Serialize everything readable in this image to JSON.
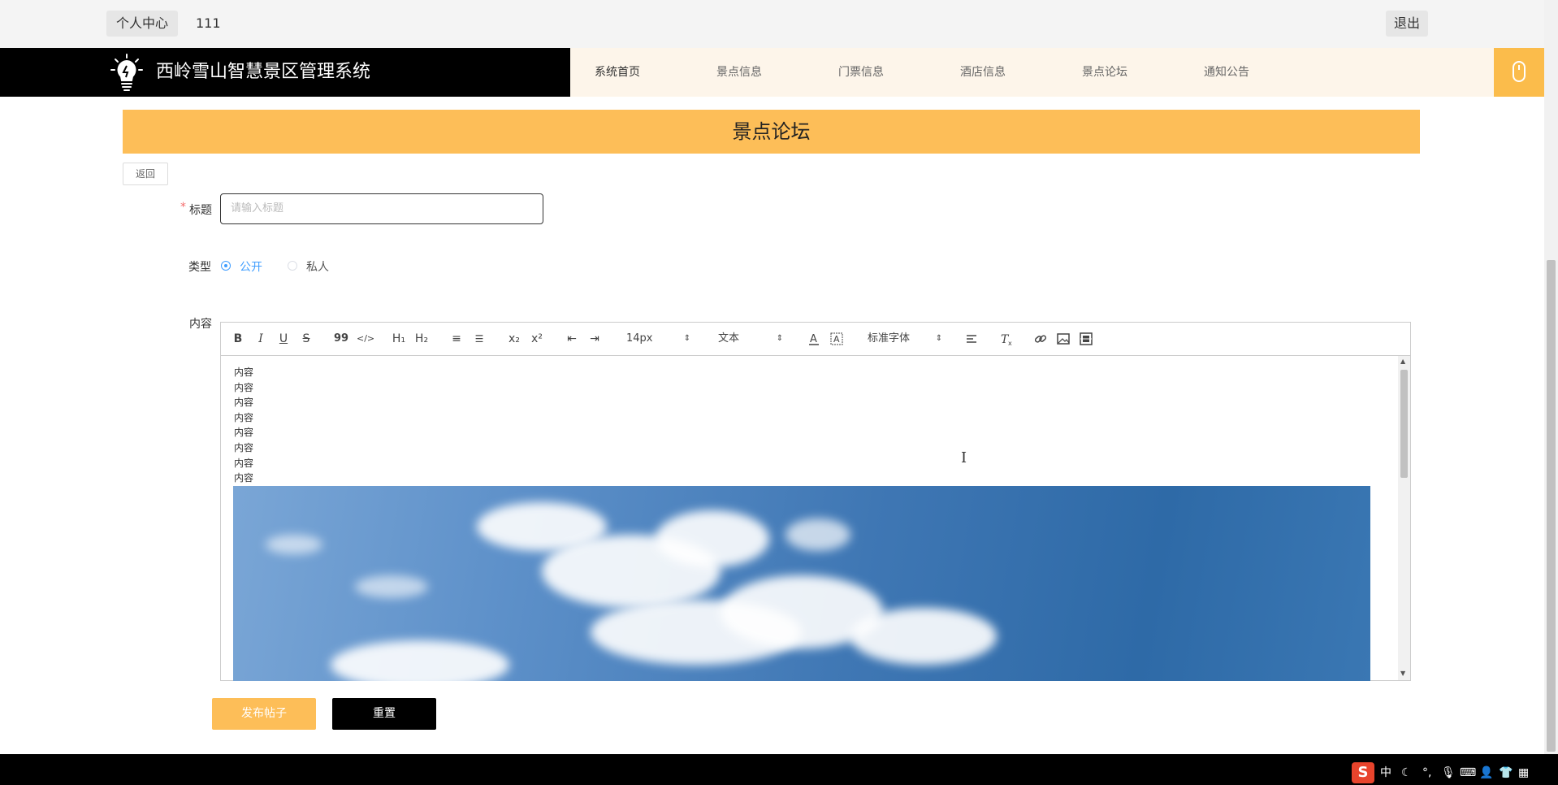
{
  "topbar": {
    "user_center": "个人中心",
    "username": "111",
    "logout": "退出"
  },
  "header": {
    "site_title": "西岭雪山智慧景区管理系统",
    "nav": [
      "系统首页",
      "景点信息",
      "门票信息",
      "酒店信息",
      "景点论坛",
      "通知公告"
    ],
    "active_nav": "系统首页"
  },
  "page": {
    "banner_title": "景点论坛",
    "back": "返回",
    "form": {
      "title_label": "标题",
      "title_required": "*",
      "title_placeholder": "请输入标题",
      "type_label": "类型",
      "type_options": [
        "公开",
        "私人"
      ],
      "type_selected": "公开",
      "content_label": "内容"
    },
    "editor": {
      "toolbar": {
        "bold": "B",
        "italic": "I",
        "underline": "U",
        "strike": "S",
        "quote": "99",
        "code": "</>",
        "h1": "H₁",
        "h2": "H₂",
        "ordered": "≡",
        "bullet": "☰",
        "sub": "x₂",
        "sup": "x²",
        "outdent": "⇤",
        "indent": "⇥",
        "size": "14px",
        "header": "文本",
        "font": "标准字体"
      },
      "content_lines": [
        "内容",
        "内容",
        "内容",
        "内容",
        "内容",
        "内容",
        "内容",
        "内容"
      ]
    },
    "buttons": {
      "submit": "发布帖子",
      "reset": "重置"
    }
  },
  "taskbar": {
    "ime": "中"
  },
  "colors": {
    "accent": "#fdbe58",
    "header_bg": "#000000",
    "nav_bg": "#fdf5ea",
    "radio": "#409eff"
  }
}
